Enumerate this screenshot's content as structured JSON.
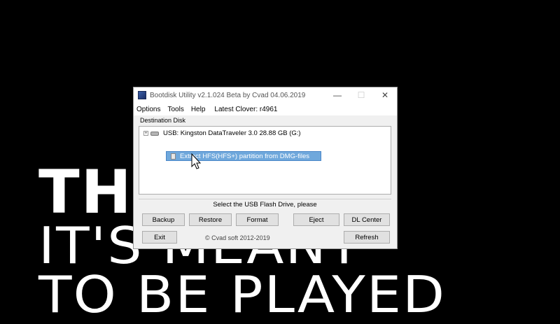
{
  "background": {
    "line1": "THIS",
    "line2": "IT'S MEANT",
    "line3": "TO BE PLAYED"
  },
  "window": {
    "title": "Bootdisk Utility v2.1.024 Beta by Cvad 04.06.2019",
    "controls": {
      "minimize": "—",
      "maximize": "☐",
      "close": "✕"
    },
    "menu": {
      "options": "Options",
      "tools": "Tools",
      "help": "Help",
      "latest_clover": "Latest Clover: r4961"
    },
    "destination_label": "Destination Disk",
    "tree": {
      "expander": "+",
      "drive_label": "USB: Kingston DataTraveler 3.0 28.88 GB (G:)"
    },
    "context_menu": {
      "item": "Extract HFS(HFS+) partition from DMG-files"
    },
    "status": "Select the USB Flash Drive, please",
    "buttons": {
      "backup": "Backup",
      "restore": "Restore",
      "format": "Format",
      "eject": "Eject",
      "dl_center": "DL Center",
      "exit": "Exit",
      "refresh": "Refresh"
    },
    "copyright": "© Cvad soft 2012-2019"
  },
  "colors": {
    "highlight": "#6fa8dc",
    "background": "#000000",
    "window": "#f0f0f0"
  }
}
